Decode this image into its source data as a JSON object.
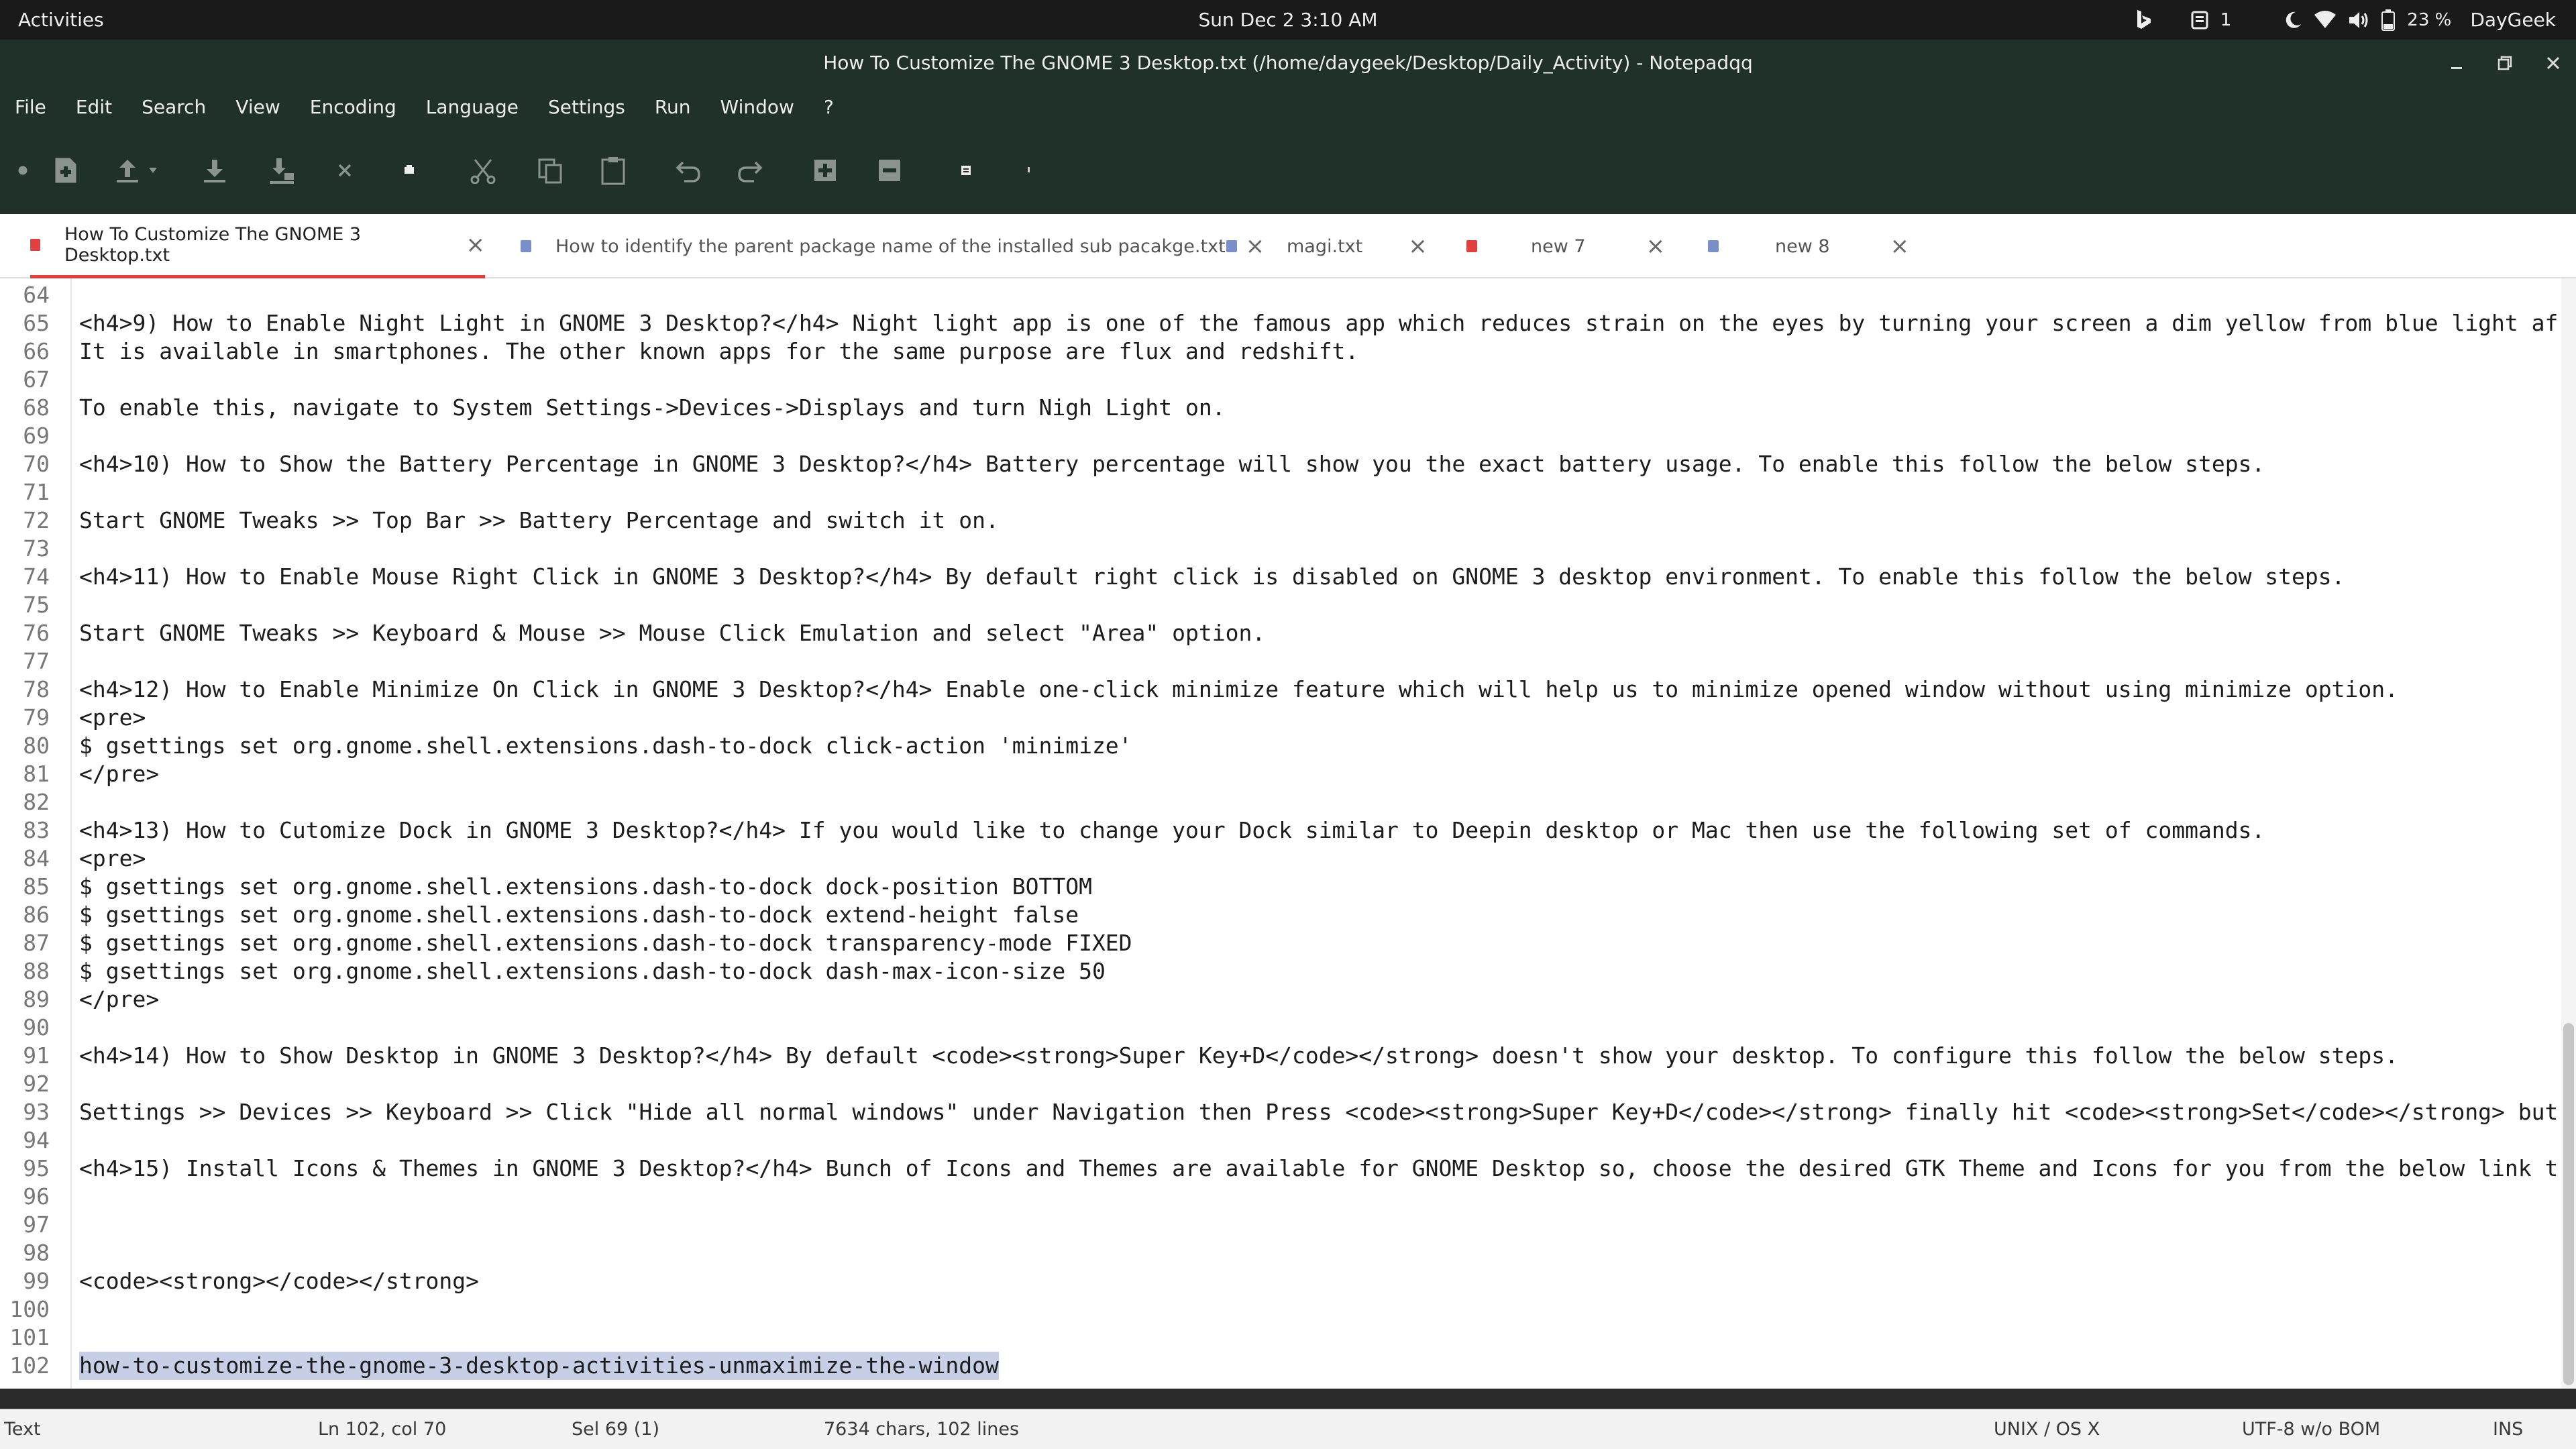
{
  "topbar": {
    "activities": "Activities",
    "clock": "Sun Dec 2  3:10 AM",
    "notification_count": "1",
    "battery": "23 %",
    "user": "DayGeek"
  },
  "window": {
    "title": "How To Customize The GNOME 3 Desktop.txt (/home/daygeek/Desktop/Daily_Activity) - Notepadqq"
  },
  "menu": [
    "File",
    "Edit",
    "Search",
    "View",
    "Encoding",
    "Language",
    "Settings",
    "Run",
    "Window",
    "?"
  ],
  "tabs": [
    {
      "label": "How To Customize The GNOME 3 Desktop.txt",
      "icon_color": "#e04040",
      "active": true
    },
    {
      "label": "How to identify the parent package name of the installed sub pacakge.txt",
      "icon_color": "#7a8fc8",
      "active": false
    },
    {
      "label": "magi.txt",
      "icon_color": "#7a8fc8",
      "active": false
    },
    {
      "label": "new 7",
      "icon_color": "#e04040",
      "active": false
    },
    {
      "label": "new 8",
      "icon_color": "#7a8fc8",
      "active": false
    }
  ],
  "editor": {
    "lines": [
      {
        "n": "64",
        "t": ""
      },
      {
        "n": "65",
        "t": "<h4>9) How to Enable Night Light in GNOME 3 Desktop?</h4> Night light app is one of the famous app which reduces strain on the eyes by turning your screen a dim yellow from blue light af"
      },
      {
        "n": "66",
        "t": "It is available in smartphones. The other known apps for the same purpose are flux and redshift."
      },
      {
        "n": "67",
        "t": ""
      },
      {
        "n": "68",
        "t": "To enable this, navigate to System Settings->Devices->Displays and turn Nigh Light on."
      },
      {
        "n": "69",
        "t": ""
      },
      {
        "n": "70",
        "t": "<h4>10) How to Show the Battery Percentage in GNOME 3 Desktop?</h4> Battery percentage will show you the exact battery usage. To enable this follow the below steps."
      },
      {
        "n": "71",
        "t": ""
      },
      {
        "n": "72",
        "t": "Start GNOME Tweaks >> Top Bar >> Battery Percentage and switch it on."
      },
      {
        "n": "73",
        "t": ""
      },
      {
        "n": "74",
        "t": "<h4>11) How to Enable Mouse Right Click in GNOME 3 Desktop?</h4> By default right click is disabled on GNOME 3 desktop environment. To enable this follow the below steps."
      },
      {
        "n": "75",
        "t": ""
      },
      {
        "n": "76",
        "t": "Start GNOME Tweaks >> Keyboard & Mouse >> Mouse Click Emulation and select \"Area\" option."
      },
      {
        "n": "77",
        "t": ""
      },
      {
        "n": "78",
        "t": "<h4>12) How to Enable Minimize On Click in GNOME 3 Desktop?</h4> Enable one-click minimize feature which will help us to minimize opened window without using minimize option."
      },
      {
        "n": "79",
        "t": "<pre>"
      },
      {
        "n": "80",
        "t": "$ gsettings set org.gnome.shell.extensions.dash-to-dock click-action 'minimize'"
      },
      {
        "n": "81",
        "t": "</pre>"
      },
      {
        "n": "82",
        "t": ""
      },
      {
        "n": "83",
        "t": "<h4>13) How to Cutomize Dock in GNOME 3 Desktop?</h4> If you would like to change your Dock similar to Deepin desktop or Mac then use the following set of commands."
      },
      {
        "n": "84",
        "t": "<pre>"
      },
      {
        "n": "85",
        "t": "$ gsettings set org.gnome.shell.extensions.dash-to-dock dock-position BOTTOM"
      },
      {
        "n": "86",
        "t": "$ gsettings set org.gnome.shell.extensions.dash-to-dock extend-height false"
      },
      {
        "n": "87",
        "t": "$ gsettings set org.gnome.shell.extensions.dash-to-dock transparency-mode FIXED"
      },
      {
        "n": "88",
        "t": "$ gsettings set org.gnome.shell.extensions.dash-to-dock dash-max-icon-size 50"
      },
      {
        "n": "89",
        "t": "</pre>"
      },
      {
        "n": "90",
        "t": ""
      },
      {
        "n": "91",
        "t": "<h4>14) How to Show Desktop in GNOME 3 Desktop?</h4> By default <code><strong>Super Key+D</code></strong> doesn't show your desktop. To configure this follow the below steps."
      },
      {
        "n": "92",
        "t": ""
      },
      {
        "n": "93",
        "t": "Settings >> Devices >> Keyboard >> Click \"Hide all normal windows\" under Navigation then Press <code><strong>Super Key+D</code></strong> finally hit <code><strong>Set</code></strong> but"
      },
      {
        "n": "94",
        "t": ""
      },
      {
        "n": "95",
        "t": "<h4>15) Install Icons & Themes in GNOME 3 Desktop?</h4> Bunch of Icons and Themes are available for GNOME Desktop so, choose the desired GTK Theme and Icons for you from the below link t"
      },
      {
        "n": "96",
        "t": ""
      },
      {
        "n": "97",
        "t": ""
      },
      {
        "n": "98",
        "t": ""
      },
      {
        "n": "99",
        "t": "<code><strong></code></strong>"
      },
      {
        "n": "100",
        "t": ""
      },
      {
        "n": "101",
        "t": ""
      },
      {
        "n": "102",
        "t": "how-to-customize-the-gnome-3-desktop-activities-unmaximize-the-window",
        "selected": true
      }
    ]
  },
  "status": {
    "mode": "Text",
    "position": "Ln 102, col 70",
    "selection": "Sel 69 (1)",
    "stats": "7634 chars, 102 lines",
    "eol": "UNIX / OS X",
    "encoding": "UTF-8 w/o BOM",
    "insert": "INS"
  },
  "colors": {
    "accent": "#e04040",
    "chrome": "#1f3128",
    "selection": "#c7cfe6"
  }
}
